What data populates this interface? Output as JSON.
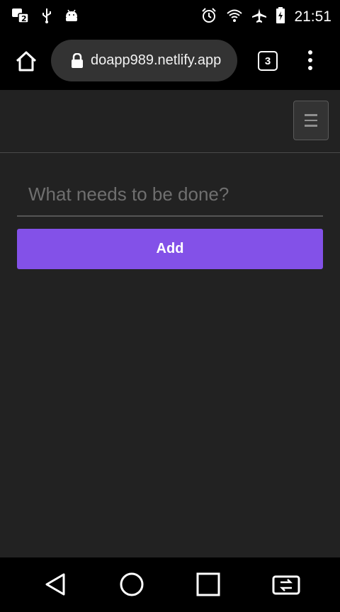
{
  "status_bar": {
    "time": "21:51",
    "icons": [
      "notification-badge-icon",
      "usb-icon",
      "android-debug-icon",
      "alarm-icon",
      "wifi-icon",
      "airplane-icon",
      "battery-icon"
    ]
  },
  "browser": {
    "url": "doapp989.netlify.app",
    "tab_count": "3",
    "icons": [
      "home-icon",
      "lock-icon",
      "more-vert-icon"
    ]
  },
  "app": {
    "input": {
      "placeholder": "What needs to be done?",
      "value": ""
    },
    "add_label": "Add",
    "colors": {
      "accent": "#8351e8",
      "background": "#222222"
    }
  },
  "nav": {
    "icons": [
      "back-icon",
      "home-circle-icon",
      "recents-icon",
      "screen-rotate-icon"
    ]
  }
}
